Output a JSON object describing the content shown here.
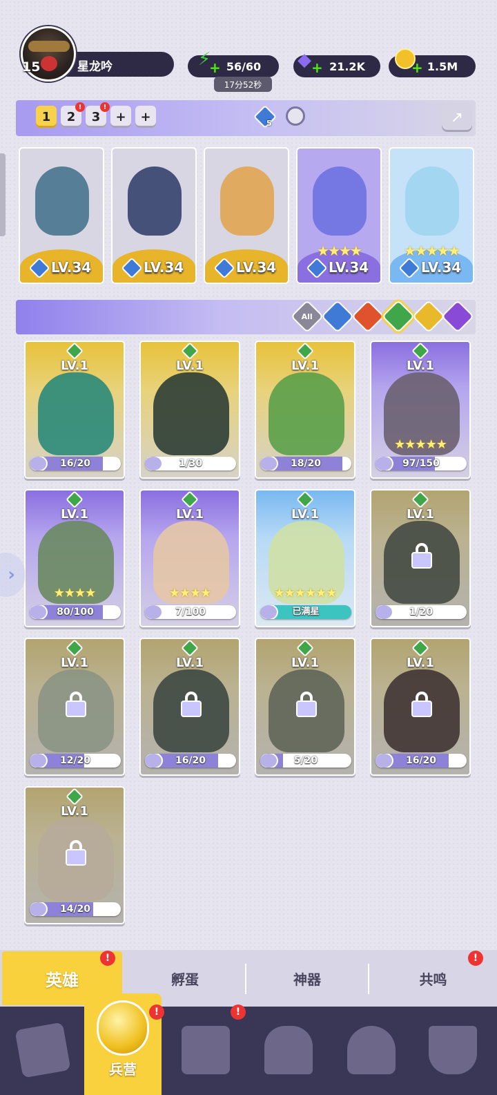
{
  "player": {
    "level": "15",
    "name": "星龙吟"
  },
  "resources": {
    "energy": "56/60",
    "energy_timer": "17分52秒",
    "gems": "21.2K",
    "gold": "1.5M"
  },
  "team_tabs": [
    {
      "label": "1",
      "active": true,
      "badge": false
    },
    {
      "label": "2",
      "active": false,
      "badge": true
    },
    {
      "label": "3",
      "active": false,
      "badge": true
    },
    {
      "label": "+",
      "active": false,
      "badge": false
    },
    {
      "label": "+",
      "active": false,
      "badge": false
    }
  ],
  "team_power_count": "5",
  "team": [
    {
      "level": "LV.34",
      "stars": "",
      "frame": "gold",
      "color": "#3f6e8a"
    },
    {
      "level": "LV.34",
      "stars": "",
      "frame": "gold",
      "color": "#2a3a66"
    },
    {
      "level": "LV.34",
      "stars": "",
      "frame": "gold",
      "color": "#e0a34a"
    },
    {
      "level": "LV.34",
      "stars": "★★★★",
      "frame": "purple",
      "color": "#6a6ee0"
    },
    {
      "level": "LV.34",
      "stars": "★★★★★",
      "frame": "blue",
      "color": "#9bd4f0"
    }
  ],
  "filters": [
    "All",
    "water",
    "fire",
    "nature",
    "light",
    "dark"
  ],
  "heroes": [
    {
      "level": "LV.1",
      "progress": "16/20",
      "fraction": 0.8,
      "stars": "",
      "frame": "gold",
      "locked": false,
      "color": "#2a8a7a"
    },
    {
      "level": "LV.1",
      "progress": "1/30",
      "fraction": 0.03,
      "stars": "",
      "frame": "gold",
      "locked": false,
      "color": "#2d3d35"
    },
    {
      "level": "LV.1",
      "progress": "18/20",
      "fraction": 0.9,
      "stars": "",
      "frame": "gold",
      "locked": false,
      "color": "#5ba04a"
    },
    {
      "level": "LV.1",
      "progress": "97/150",
      "fraction": 0.65,
      "stars": "★★★★★",
      "frame": "purple",
      "locked": false,
      "color": "#6a6070"
    },
    {
      "level": "LV.1",
      "progress": "80/100",
      "fraction": 0.8,
      "stars": "★★★★",
      "frame": "purple",
      "locked": false,
      "color": "#6a8a60"
    },
    {
      "level": "LV.1",
      "progress": "7/100",
      "fraction": 0.07,
      "stars": "★★★★",
      "frame": "purple",
      "locked": false,
      "color": "#e6c6a6"
    },
    {
      "level": "LV.1",
      "progress": "已满星",
      "fraction": 1.0,
      "stars": "★★★★★★",
      "frame": "blue",
      "locked": false,
      "color": "#cfe0a6"
    },
    {
      "level": "LV.1",
      "progress": "1/20",
      "fraction": 0.05,
      "stars": "",
      "frame": "gold",
      "locked": true,
      "color": "#4a5a48"
    },
    {
      "level": "LV.1",
      "progress": "12/20",
      "fraction": 0.6,
      "stars": "",
      "frame": "gold",
      "locked": true,
      "color": "#9ab28a"
    },
    {
      "level": "LV.1",
      "progress": "16/20",
      "fraction": 0.8,
      "stars": "",
      "frame": "gold",
      "locked": true,
      "color": "#3a5a4a"
    },
    {
      "level": "LV.1",
      "progress": "5/20",
      "fraction": 0.25,
      "stars": "",
      "frame": "gold",
      "locked": true,
      "color": "#6a7a5a"
    },
    {
      "level": "LV.1",
      "progress": "16/20",
      "fraction": 0.8,
      "stars": "",
      "frame": "gold",
      "locked": true,
      "color": "#5a3a3a"
    },
    {
      "level": "LV.1",
      "progress": "14/20",
      "fraction": 0.7,
      "stars": "",
      "frame": "gold",
      "locked": true,
      "color": "#e6c89a"
    }
  ],
  "sub_tabs": [
    {
      "label": "英雄",
      "active": true,
      "badge": true
    },
    {
      "label": "孵蛋",
      "active": false,
      "badge": false
    },
    {
      "label": "神器",
      "active": false,
      "badge": false
    },
    {
      "label": "共鸣",
      "active": false,
      "badge": true
    }
  ],
  "nav": {
    "active_label": "兵营",
    "items": [
      "cards-icon",
      "barracks-icon",
      "map-icon",
      "castle-icon",
      "mushroom-icon",
      "guild-icon"
    ]
  },
  "colors": {
    "gold_frame": "#e8c23a",
    "purple_frame": "#8a6fe0",
    "blue_frame": "#7ab6f0",
    "accent_yellow": "#f8d13d",
    "nav_bg": "#3a3656"
  }
}
